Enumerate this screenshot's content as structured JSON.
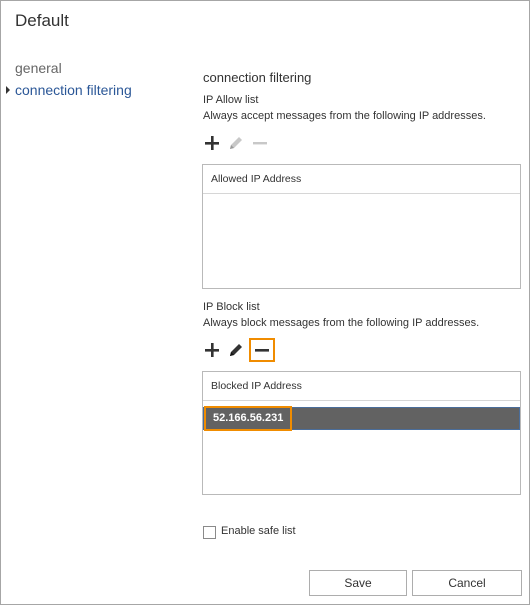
{
  "window": {
    "title": "Default"
  },
  "nav": {
    "items": [
      {
        "label": "general"
      },
      {
        "label": "connection filtering"
      }
    ]
  },
  "main": {
    "heading": "connection filtering",
    "allow_list": {
      "title": "IP Allow list",
      "description": "Always accept messages from the following IP addresses.",
      "column_header": "Allowed IP Address",
      "rows": []
    },
    "block_list": {
      "title": "IP Block list",
      "description": "Always block messages from the following IP addresses.",
      "column_header": "Blocked IP Address",
      "rows": [
        "52.166.56.231"
      ]
    },
    "safe_list": {
      "label": "Enable safe list",
      "checked": false
    }
  },
  "buttons": {
    "save": "Save",
    "cancel": "Cancel"
  },
  "icons": {
    "add": "plus-icon",
    "edit": "pencil-icon",
    "remove": "minus-icon"
  },
  "colors": {
    "nav_active": "#2b5797",
    "highlight": "#f08c00",
    "selected_row": "#626262"
  }
}
